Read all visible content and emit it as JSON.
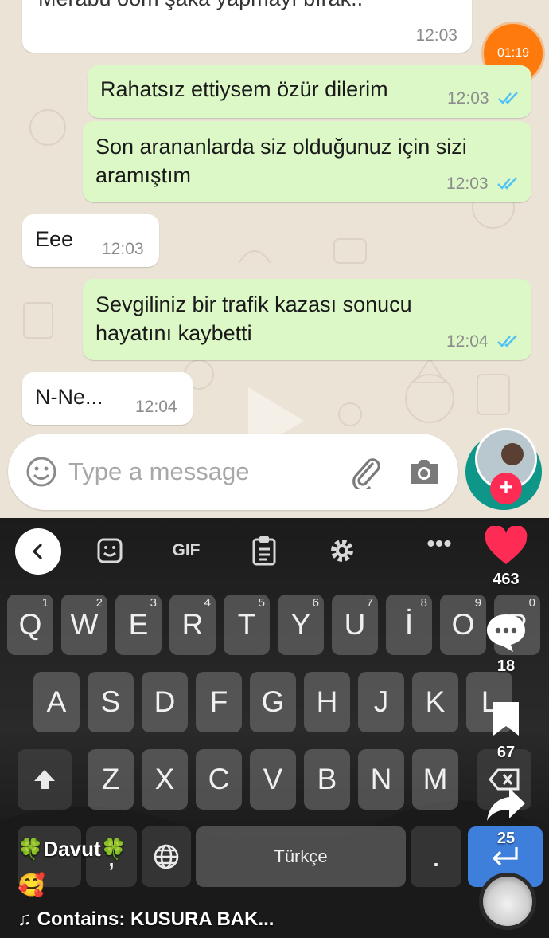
{
  "chat": {
    "messages": [
      {
        "dir": "in",
        "text": "Merabu oom şaka yapmayı bırak..",
        "time": "12:03"
      },
      {
        "dir": "out",
        "text": "Rahatsız ettiysem özür dilerim",
        "time": "12:03"
      },
      {
        "dir": "out",
        "text": [
          "Son arananlarda siz olduğunuz için sizi",
          "aramıştım"
        ],
        "time": "12:03"
      },
      {
        "dir": "in",
        "text": "Eee",
        "time": "12:03"
      },
      {
        "dir": "out",
        "text": [
          "Sevgiliniz bir trafik kazası sonucu",
          "hayatını kaybetti"
        ],
        "time": "12:04"
      },
      {
        "dir": "in",
        "text": "N-Ne...",
        "time": "12:04"
      }
    ],
    "timer": "01:19",
    "composer_placeholder": "Type a message",
    "colors": {
      "incoming": "#ffffff",
      "outgoing": "#dcf8c6",
      "read_ticks": "#4fc3f7",
      "accent": "#0e9688"
    }
  },
  "keyboard": {
    "toolbar": {
      "gif_label": "GIF"
    },
    "rows": [
      [
        {
          "k": "Q",
          "n": "1"
        },
        {
          "k": "W",
          "n": "2"
        },
        {
          "k": "E",
          "n": "3"
        },
        {
          "k": "R",
          "n": "4"
        },
        {
          "k": "T",
          "n": "5"
        },
        {
          "k": "Y",
          "n": "6"
        },
        {
          "k": "U",
          "n": "7"
        },
        {
          "k": "İ",
          "n": "8"
        },
        {
          "k": "O",
          "n": "9"
        },
        {
          "k": "P",
          "n": "0"
        }
      ],
      [
        {
          "k": "A"
        },
        {
          "k": "S"
        },
        {
          "k": "D"
        },
        {
          "k": "F"
        },
        {
          "k": "G"
        },
        {
          "k": "H"
        },
        {
          "k": "J"
        },
        {
          "k": "K"
        },
        {
          "k": "L"
        }
      ],
      [
        {
          "k": "Z"
        },
        {
          "k": "X"
        },
        {
          "k": "C"
        },
        {
          "k": "V"
        },
        {
          "k": "B"
        },
        {
          "k": "N"
        },
        {
          "k": "M"
        }
      ]
    ],
    "space_label": "Türkçe",
    "comma": ",",
    "period": "."
  },
  "tiktok": {
    "likes": "463",
    "comments": "18",
    "saves": "67",
    "shares": "25",
    "author": "🍀Davut🍀",
    "caption_emoji": "🥰",
    "music": "♫ Contains: KUSURA BAK...",
    "like_color": "#fe2c55"
  }
}
